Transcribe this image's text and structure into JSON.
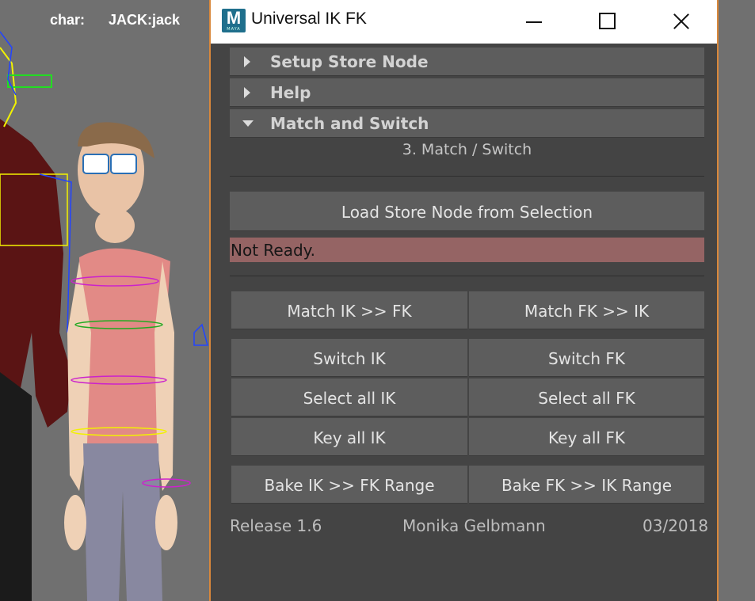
{
  "viewport": {
    "hud_label": "char:",
    "hud_value": "JACK:jack"
  },
  "window": {
    "title": "Universal IK FK",
    "icon": "maya-app-icon",
    "icon_letter": "M",
    "icon_subtext": "MAYA"
  },
  "sections": [
    {
      "label": "Setup Store Node",
      "expanded": false
    },
    {
      "label": "Help",
      "expanded": false
    },
    {
      "label": "Match and Switch",
      "expanded": true
    }
  ],
  "match_switch": {
    "subtitle": "3. Match / Switch",
    "load_button": "Load Store Node from Selection",
    "status": "Not Ready.",
    "status_color": "#956464",
    "match_ik_fk": "Match IK >> FK",
    "match_fk_ik": "Match FK >> IK",
    "switch_ik": "Switch IK",
    "switch_fk": "Switch FK",
    "select_all_ik": "Select all IK",
    "select_all_fk": "Select all FK",
    "key_all_ik": "Key all IK",
    "key_all_fk": "Key all FK",
    "bake_ik_fk": "Bake IK >> FK Range",
    "bake_fk_ik": "Bake FK >> IK Range"
  },
  "footer": {
    "release": "Release 1.6",
    "author": "Monika Gelbmann",
    "date": "03/2018"
  },
  "colors": {
    "window_bg": "#444444",
    "button_bg": "#5d5d5d",
    "window_border": "#d9883b"
  }
}
